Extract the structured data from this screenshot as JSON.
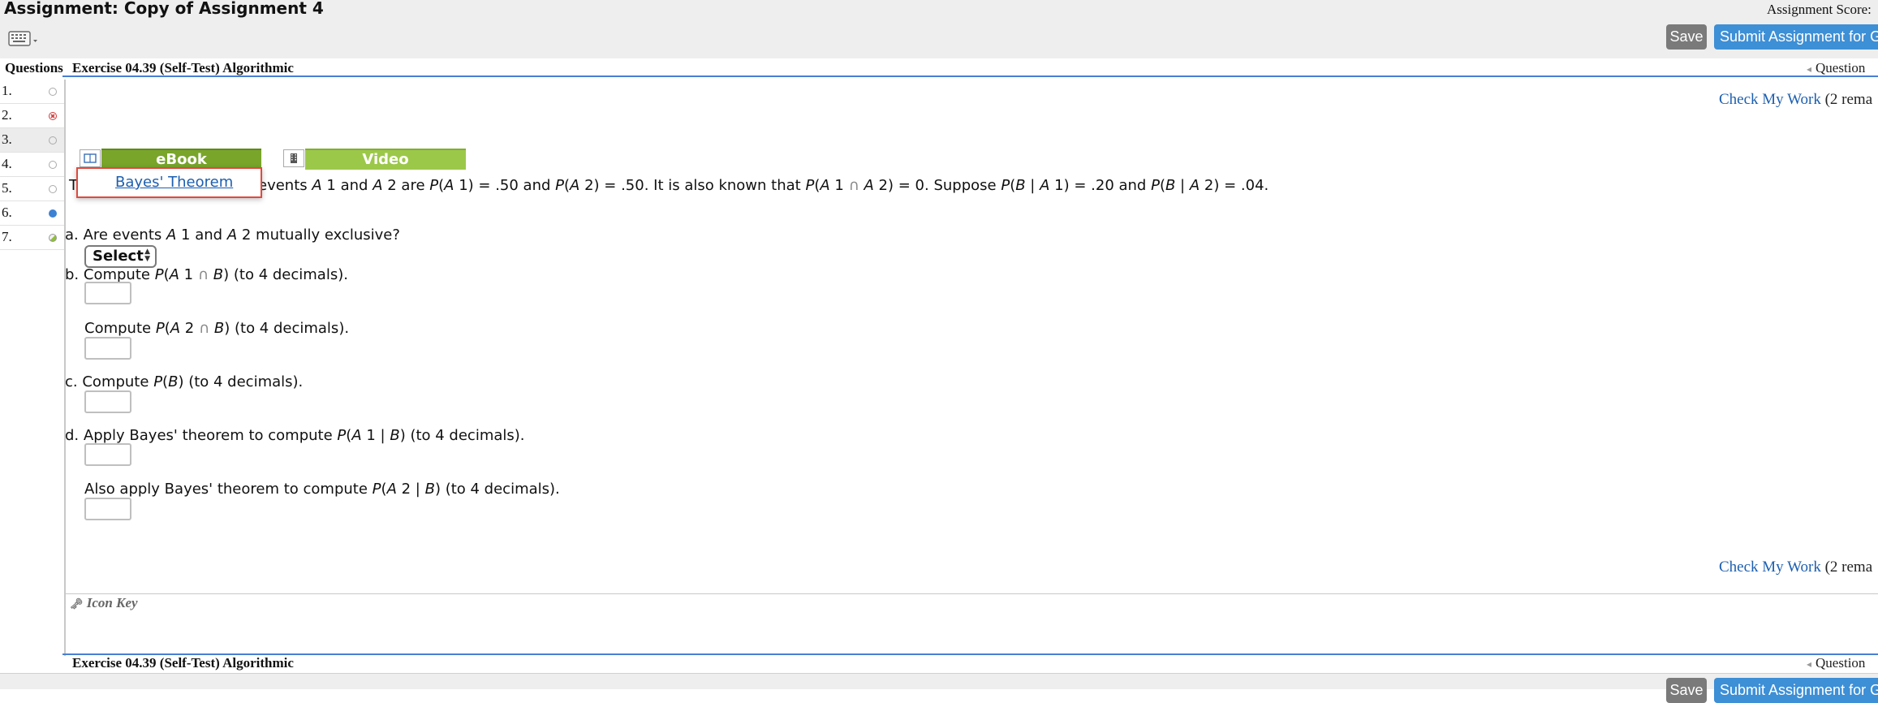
{
  "header": {
    "title": "Assignment: Copy of Assignment 4",
    "score_label": "Assignment Score:",
    "save_label": "Save",
    "submit_label": "Submit Assignment for G"
  },
  "question_header": {
    "questions_label": "Questions",
    "exercise_title": "Exercise 04.39 (Self-Test) Algorithmic",
    "nav_label": "Question"
  },
  "sidebar": {
    "items": [
      {
        "num": "1.",
        "status": "unanswered"
      },
      {
        "num": "2.",
        "status": "incorrect"
      },
      {
        "num": "3.",
        "status": "unanswered"
      },
      {
        "num": "4.",
        "status": "unanswered"
      },
      {
        "num": "5.",
        "status": "unanswered"
      },
      {
        "num": "6.",
        "status": "current"
      },
      {
        "num": "7.",
        "status": "partial"
      }
    ]
  },
  "main": {
    "check_work_label": "Check My Work",
    "check_work_remaining": "(2 rema",
    "ebook_tab": "eBook",
    "video_tab": "Video",
    "popup_link": "Bayes' Theorem",
    "intro_fragment": "T",
    "part_a": {
      "label": "a.",
      "text": "Are events",
      "mid": "mutually exclusive?",
      "select_value": "Select"
    },
    "part_b1": {
      "label": "b.",
      "pre": "Compute",
      "post": "(to 4 decimals)."
    },
    "part_b2": {
      "pre": "Compute",
      "post": "(to 4 decimals)."
    },
    "part_c": {
      "label": "c.",
      "pre": "Compute",
      "post": "(to 4 decimals)."
    },
    "part_d1": {
      "label": "d.",
      "pre": "Apply Bayes' theorem to compute",
      "post": "(to 4 decimals)."
    },
    "part_d2": {
      "pre": "Also apply Bayes' theorem to compute",
      "post": "(to 4 decimals)."
    },
    "icon_key": "Icon Key"
  },
  "colors": {
    "accent_blue": "#3d8fd6",
    "ebook_green": "#79a52b",
    "video_green": "#9cc84a",
    "popup_border": "#e04a3f",
    "incorrect_red": "#d33a3a",
    "current_blue": "#3b82d4"
  }
}
